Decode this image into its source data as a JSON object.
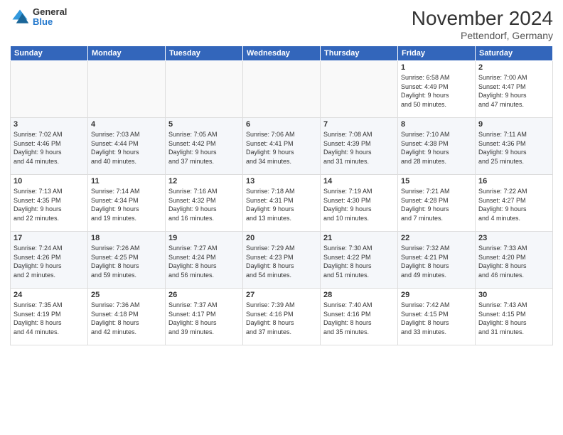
{
  "header": {
    "logo": {
      "general": "General",
      "blue": "Blue"
    },
    "title": "November 2024",
    "location": "Pettendorf, Germany"
  },
  "weekdays": [
    "Sunday",
    "Monday",
    "Tuesday",
    "Wednesday",
    "Thursday",
    "Friday",
    "Saturday"
  ],
  "weeks": [
    [
      {
        "day": "",
        "info": ""
      },
      {
        "day": "",
        "info": ""
      },
      {
        "day": "",
        "info": ""
      },
      {
        "day": "",
        "info": ""
      },
      {
        "day": "",
        "info": ""
      },
      {
        "day": "1",
        "info": "Sunrise: 6:58 AM\nSunset: 4:49 PM\nDaylight: 9 hours\nand 50 minutes."
      },
      {
        "day": "2",
        "info": "Sunrise: 7:00 AM\nSunset: 4:47 PM\nDaylight: 9 hours\nand 47 minutes."
      }
    ],
    [
      {
        "day": "3",
        "info": "Sunrise: 7:02 AM\nSunset: 4:46 PM\nDaylight: 9 hours\nand 44 minutes."
      },
      {
        "day": "4",
        "info": "Sunrise: 7:03 AM\nSunset: 4:44 PM\nDaylight: 9 hours\nand 40 minutes."
      },
      {
        "day": "5",
        "info": "Sunrise: 7:05 AM\nSunset: 4:42 PM\nDaylight: 9 hours\nand 37 minutes."
      },
      {
        "day": "6",
        "info": "Sunrise: 7:06 AM\nSunset: 4:41 PM\nDaylight: 9 hours\nand 34 minutes."
      },
      {
        "day": "7",
        "info": "Sunrise: 7:08 AM\nSunset: 4:39 PM\nDaylight: 9 hours\nand 31 minutes."
      },
      {
        "day": "8",
        "info": "Sunrise: 7:10 AM\nSunset: 4:38 PM\nDaylight: 9 hours\nand 28 minutes."
      },
      {
        "day": "9",
        "info": "Sunrise: 7:11 AM\nSunset: 4:36 PM\nDaylight: 9 hours\nand 25 minutes."
      }
    ],
    [
      {
        "day": "10",
        "info": "Sunrise: 7:13 AM\nSunset: 4:35 PM\nDaylight: 9 hours\nand 22 minutes."
      },
      {
        "day": "11",
        "info": "Sunrise: 7:14 AM\nSunset: 4:34 PM\nDaylight: 9 hours\nand 19 minutes."
      },
      {
        "day": "12",
        "info": "Sunrise: 7:16 AM\nSunset: 4:32 PM\nDaylight: 9 hours\nand 16 minutes."
      },
      {
        "day": "13",
        "info": "Sunrise: 7:18 AM\nSunset: 4:31 PM\nDaylight: 9 hours\nand 13 minutes."
      },
      {
        "day": "14",
        "info": "Sunrise: 7:19 AM\nSunset: 4:30 PM\nDaylight: 9 hours\nand 10 minutes."
      },
      {
        "day": "15",
        "info": "Sunrise: 7:21 AM\nSunset: 4:28 PM\nDaylight: 9 hours\nand 7 minutes."
      },
      {
        "day": "16",
        "info": "Sunrise: 7:22 AM\nSunset: 4:27 PM\nDaylight: 9 hours\nand 4 minutes."
      }
    ],
    [
      {
        "day": "17",
        "info": "Sunrise: 7:24 AM\nSunset: 4:26 PM\nDaylight: 9 hours\nand 2 minutes."
      },
      {
        "day": "18",
        "info": "Sunrise: 7:26 AM\nSunset: 4:25 PM\nDaylight: 8 hours\nand 59 minutes."
      },
      {
        "day": "19",
        "info": "Sunrise: 7:27 AM\nSunset: 4:24 PM\nDaylight: 8 hours\nand 56 minutes."
      },
      {
        "day": "20",
        "info": "Sunrise: 7:29 AM\nSunset: 4:23 PM\nDaylight: 8 hours\nand 54 minutes."
      },
      {
        "day": "21",
        "info": "Sunrise: 7:30 AM\nSunset: 4:22 PM\nDaylight: 8 hours\nand 51 minutes."
      },
      {
        "day": "22",
        "info": "Sunrise: 7:32 AM\nSunset: 4:21 PM\nDaylight: 8 hours\nand 49 minutes."
      },
      {
        "day": "23",
        "info": "Sunrise: 7:33 AM\nSunset: 4:20 PM\nDaylight: 8 hours\nand 46 minutes."
      }
    ],
    [
      {
        "day": "24",
        "info": "Sunrise: 7:35 AM\nSunset: 4:19 PM\nDaylight: 8 hours\nand 44 minutes."
      },
      {
        "day": "25",
        "info": "Sunrise: 7:36 AM\nSunset: 4:18 PM\nDaylight: 8 hours\nand 42 minutes."
      },
      {
        "day": "26",
        "info": "Sunrise: 7:37 AM\nSunset: 4:17 PM\nDaylight: 8 hours\nand 39 minutes."
      },
      {
        "day": "27",
        "info": "Sunrise: 7:39 AM\nSunset: 4:16 PM\nDaylight: 8 hours\nand 37 minutes."
      },
      {
        "day": "28",
        "info": "Sunrise: 7:40 AM\nSunset: 4:16 PM\nDaylight: 8 hours\nand 35 minutes."
      },
      {
        "day": "29",
        "info": "Sunrise: 7:42 AM\nSunset: 4:15 PM\nDaylight: 8 hours\nand 33 minutes."
      },
      {
        "day": "30",
        "info": "Sunrise: 7:43 AM\nSunset: 4:15 PM\nDaylight: 8 hours\nand 31 minutes."
      }
    ]
  ]
}
